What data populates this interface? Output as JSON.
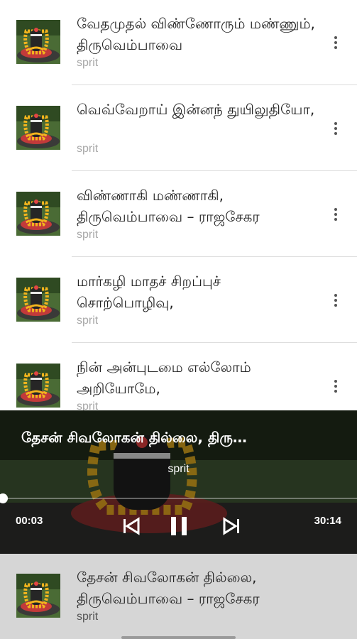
{
  "playlist": [
    {
      "title": "வேதமுதல் விண்ணோரும் மண்ணும், திருவெம்பாவை",
      "artist": "sprit"
    },
    {
      "title": "வெவ்வேறாய் இன்னந் துயிலுதியோ,",
      "artist": "sprit"
    },
    {
      "title": "விண்ணாகி மண்ணாகி, திருவெம்பாவை – ராஜசேகர",
      "artist": "sprit"
    },
    {
      "title": "மார்கழி மாதச் சிறப்புச் சொற்பொழிவு,",
      "artist": "sprit"
    },
    {
      "title": "நின் அன்புடமை எல்லோம் அறியோமே,",
      "artist": "sprit"
    }
  ],
  "player": {
    "title": "தேசன் சிவலோகன் தில்லை, திரு…",
    "artist": "sprit",
    "current_time": "00:03",
    "total_time": "30:14",
    "progress": 0.002
  },
  "mini_player": {
    "title": "தேசன் சிவலோகன் தில்லை, திருவெம்பாவை – ராஜசேகர",
    "artist": "sprit"
  },
  "icons": {
    "more": "more-vert-icon",
    "prev": "skip-previous-icon",
    "pause": "pause-icon",
    "next": "skip-next-icon"
  },
  "colors": {
    "subtitle": "#a8a8a8",
    "divider": "#dddddd",
    "mini_bg": "#d6d6d6"
  }
}
